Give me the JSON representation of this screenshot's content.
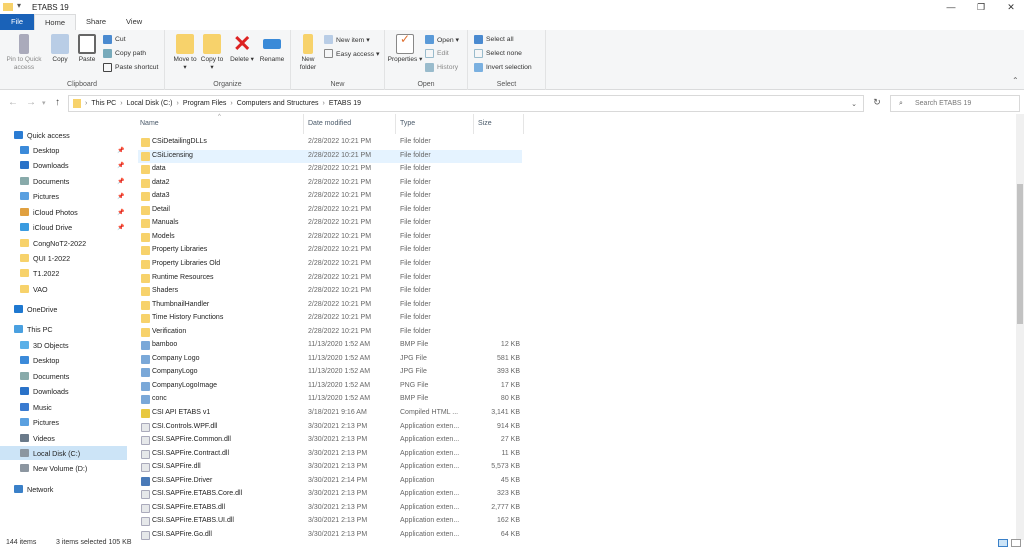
{
  "window": {
    "title": "ETABS 19",
    "minimize": "—",
    "maximize": "❐",
    "close": "✕"
  },
  "tabs": [
    "File",
    "Home",
    "Share",
    "View"
  ],
  "ribbon": {
    "clipboard": {
      "label": "Clipboard",
      "pin": "Pin to Quick access",
      "copy": "Copy",
      "paste": "Paste",
      "cut": "Cut",
      "copy_path": "Copy path",
      "paste_shortcut": "Paste shortcut"
    },
    "organize": {
      "label": "Organize",
      "move_to": "Move to ▾",
      "copy_to": "Copy to ▾",
      "delete": "Delete ▾",
      "rename": "Rename"
    },
    "new": {
      "label": "New",
      "new_folder": "New folder",
      "new_item": "New item ▾",
      "easy_access": "Easy access ▾"
    },
    "open": {
      "label": "Open",
      "properties": "Properties ▾",
      "open": "Open ▾",
      "edit": "Edit",
      "history": "History"
    },
    "select": {
      "label": "Select",
      "select_all": "Select all",
      "select_none": "Select none",
      "invert": "Invert selection"
    }
  },
  "address": {
    "path": [
      "This PC",
      "Local Disk (C:)",
      "Program Files",
      "Computers and Structures",
      "ETABS 19"
    ],
    "search_placeholder": "Search ETABS 19"
  },
  "sidebar": [
    {
      "label": "Quick access",
      "icon": "star-icon",
      "color": "#2b7cd3",
      "indent": 0,
      "pinned": false
    },
    {
      "label": "Desktop",
      "icon": "desktop-icon",
      "color": "#3b8ad9",
      "indent": 1,
      "pinned": true
    },
    {
      "label": "Downloads",
      "icon": "download-icon",
      "color": "#2a72c8",
      "indent": 1,
      "pinned": true
    },
    {
      "label": "Documents",
      "icon": "documents-icon",
      "color": "#8aa",
      "indent": 1,
      "pinned": true
    },
    {
      "label": "Pictures",
      "icon": "pictures-icon",
      "color": "#5aa0e0",
      "indent": 1,
      "pinned": true
    },
    {
      "label": "iCloud Photos",
      "icon": "icloud-photos-icon",
      "color": "#e0a040",
      "indent": 1,
      "pinned": true
    },
    {
      "label": "iCloud Drive",
      "icon": "icloud-drive-icon",
      "color": "#3a9be0",
      "indent": 1,
      "pinned": true
    },
    {
      "label": "CongNoT2-2022",
      "icon": "folder-icon",
      "color": "#f7d26b",
      "indent": 1,
      "pinned": false
    },
    {
      "label": "QUI 1-2022",
      "icon": "folder-icon",
      "color": "#f7d26b",
      "indent": 1,
      "pinned": false
    },
    {
      "label": "T1.2022",
      "icon": "folder-icon",
      "color": "#f7d26b",
      "indent": 1,
      "pinned": false
    },
    {
      "label": "VAO",
      "icon": "folder-icon",
      "color": "#f7d26b",
      "indent": 1,
      "pinned": false
    },
    {
      "label": "OneDrive",
      "icon": "onedrive-icon",
      "color": "#1e78d0",
      "indent": 0,
      "pinned": false
    },
    {
      "label": "This PC",
      "icon": "pc-icon",
      "color": "#4aa0e0",
      "indent": 0,
      "pinned": false
    },
    {
      "label": "3D Objects",
      "icon": "3d-objects-icon",
      "color": "#5ab0e8",
      "indent": 1,
      "pinned": false
    },
    {
      "label": "Desktop",
      "icon": "desktop-icon",
      "color": "#3b8ad9",
      "indent": 1,
      "pinned": false
    },
    {
      "label": "Documents",
      "icon": "documents-icon",
      "color": "#8aa",
      "indent": 1,
      "pinned": false
    },
    {
      "label": "Downloads",
      "icon": "download-icon",
      "color": "#2a72c8",
      "indent": 1,
      "pinned": false
    },
    {
      "label": "Music",
      "icon": "music-icon",
      "color": "#3a7bd0",
      "indent": 1,
      "pinned": false
    },
    {
      "label": "Pictures",
      "icon": "pictures-icon",
      "color": "#5aa0e0",
      "indent": 1,
      "pinned": false
    },
    {
      "label": "Videos",
      "icon": "videos-icon",
      "color": "#6a7a8a",
      "indent": 1,
      "pinned": false
    },
    {
      "label": "Local Disk (C:)",
      "icon": "drive-icon",
      "color": "#8c96a0",
      "indent": 1,
      "pinned": false,
      "selected": true
    },
    {
      "label": "New Volume (D:)",
      "icon": "drive-icon",
      "color": "#8c96a0",
      "indent": 1,
      "pinned": false
    },
    {
      "label": "Network",
      "icon": "network-icon",
      "color": "#3a80c8",
      "indent": 0,
      "pinned": false
    }
  ],
  "columns": {
    "name": "Name",
    "date": "Date modified",
    "type": "Type",
    "size": "Size"
  },
  "files": [
    {
      "name": "CSiDetailingDLLs",
      "date": "2/28/2022 10:21 PM",
      "type": "File folder",
      "size": "",
      "kind": "folder"
    },
    {
      "name": "CSiLicensing",
      "date": "2/28/2022 10:21 PM",
      "type": "File folder",
      "size": "",
      "kind": "folder",
      "selected": true
    },
    {
      "name": "data",
      "date": "2/28/2022 10:21 PM",
      "type": "File folder",
      "size": "",
      "kind": "folder"
    },
    {
      "name": "data2",
      "date": "2/28/2022 10:21 PM",
      "type": "File folder",
      "size": "",
      "kind": "folder"
    },
    {
      "name": "data3",
      "date": "2/28/2022 10:21 PM",
      "type": "File folder",
      "size": "",
      "kind": "folder"
    },
    {
      "name": "Detail",
      "date": "2/28/2022 10:21 PM",
      "type": "File folder",
      "size": "",
      "kind": "folder"
    },
    {
      "name": "Manuals",
      "date": "2/28/2022 10:21 PM",
      "type": "File folder",
      "size": "",
      "kind": "folder"
    },
    {
      "name": "Models",
      "date": "2/28/2022 10:21 PM",
      "type": "File folder",
      "size": "",
      "kind": "folder"
    },
    {
      "name": "Property Libraries",
      "date": "2/28/2022 10:21 PM",
      "type": "File folder",
      "size": "",
      "kind": "folder"
    },
    {
      "name": "Property Libraries Old",
      "date": "2/28/2022 10:21 PM",
      "type": "File folder",
      "size": "",
      "kind": "folder"
    },
    {
      "name": "Runtime Resources",
      "date": "2/28/2022 10:21 PM",
      "type": "File folder",
      "size": "",
      "kind": "folder"
    },
    {
      "name": "Shaders",
      "date": "2/28/2022 10:21 PM",
      "type": "File folder",
      "size": "",
      "kind": "folder"
    },
    {
      "name": "ThumbnailHandler",
      "date": "2/28/2022 10:21 PM",
      "type": "File folder",
      "size": "",
      "kind": "folder"
    },
    {
      "name": "Time History Functions",
      "date": "2/28/2022 10:21 PM",
      "type": "File folder",
      "size": "",
      "kind": "folder"
    },
    {
      "name": "Verification",
      "date": "2/28/2022 10:21 PM",
      "type": "File folder",
      "size": "",
      "kind": "folder"
    },
    {
      "name": "bamboo",
      "date": "11/13/2020 1:52 AM",
      "type": "BMP File",
      "size": "12 KB",
      "kind": "image"
    },
    {
      "name": "Company Logo",
      "date": "11/13/2020 1:52 AM",
      "type": "JPG File",
      "size": "581 KB",
      "kind": "image"
    },
    {
      "name": "CompanyLogo",
      "date": "11/13/2020 1:52 AM",
      "type": "JPG File",
      "size": "393 KB",
      "kind": "image"
    },
    {
      "name": "CompanyLogoImage",
      "date": "11/13/2020 1:52 AM",
      "type": "PNG File",
      "size": "17 KB",
      "kind": "image"
    },
    {
      "name": "conc",
      "date": "11/13/2020 1:52 AM",
      "type": "BMP File",
      "size": "80 KB",
      "kind": "image"
    },
    {
      "name": "CSI API ETABS v1",
      "date": "3/18/2021 9:16 AM",
      "type": "Compiled HTML ...",
      "size": "3,141 KB",
      "kind": "help"
    },
    {
      "name": "CSI.Controls.WPF.dll",
      "date": "3/30/2021 2:13 PM",
      "type": "Application exten...",
      "size": "914 KB",
      "kind": "dll"
    },
    {
      "name": "CSI.SAPFire.Common.dll",
      "date": "3/30/2021 2:13 PM",
      "type": "Application exten...",
      "size": "27 KB",
      "kind": "dll"
    },
    {
      "name": "CSI.SAPFire.Contract.dll",
      "date": "3/30/2021 2:13 PM",
      "type": "Application exten...",
      "size": "11 KB",
      "kind": "dll"
    },
    {
      "name": "CSI.SAPFire.dll",
      "date": "3/30/2021 2:13 PM",
      "type": "Application exten...",
      "size": "5,573 KB",
      "kind": "dll"
    },
    {
      "name": "CSI.SAPFire.Driver",
      "date": "3/30/2021 2:14 PM",
      "type": "Application",
      "size": "45 KB",
      "kind": "app"
    },
    {
      "name": "CSI.SAPFire.ETABS.Core.dll",
      "date": "3/30/2021 2:13 PM",
      "type": "Application exten...",
      "size": "323 KB",
      "kind": "dll"
    },
    {
      "name": "CSI.SAPFire.ETABS.dll",
      "date": "3/30/2021 2:13 PM",
      "type": "Application exten...",
      "size": "2,777 KB",
      "kind": "dll"
    },
    {
      "name": "CSI.SAPFire.ETABS.UI.dll",
      "date": "3/30/2021 2:13 PM",
      "type": "Application exten...",
      "size": "162 KB",
      "kind": "dll"
    },
    {
      "name": "CSI.SAPFire.Go.dll",
      "date": "3/30/2021 2:13 PM",
      "type": "Application exten...",
      "size": "64 KB",
      "kind": "dll"
    }
  ],
  "status": {
    "count": "144 items",
    "selected": "3 items selected  105 KB"
  },
  "colors": {
    "accent": "#1a62b8",
    "selection": "#cce4f7",
    "folder": "#f7d26b"
  }
}
